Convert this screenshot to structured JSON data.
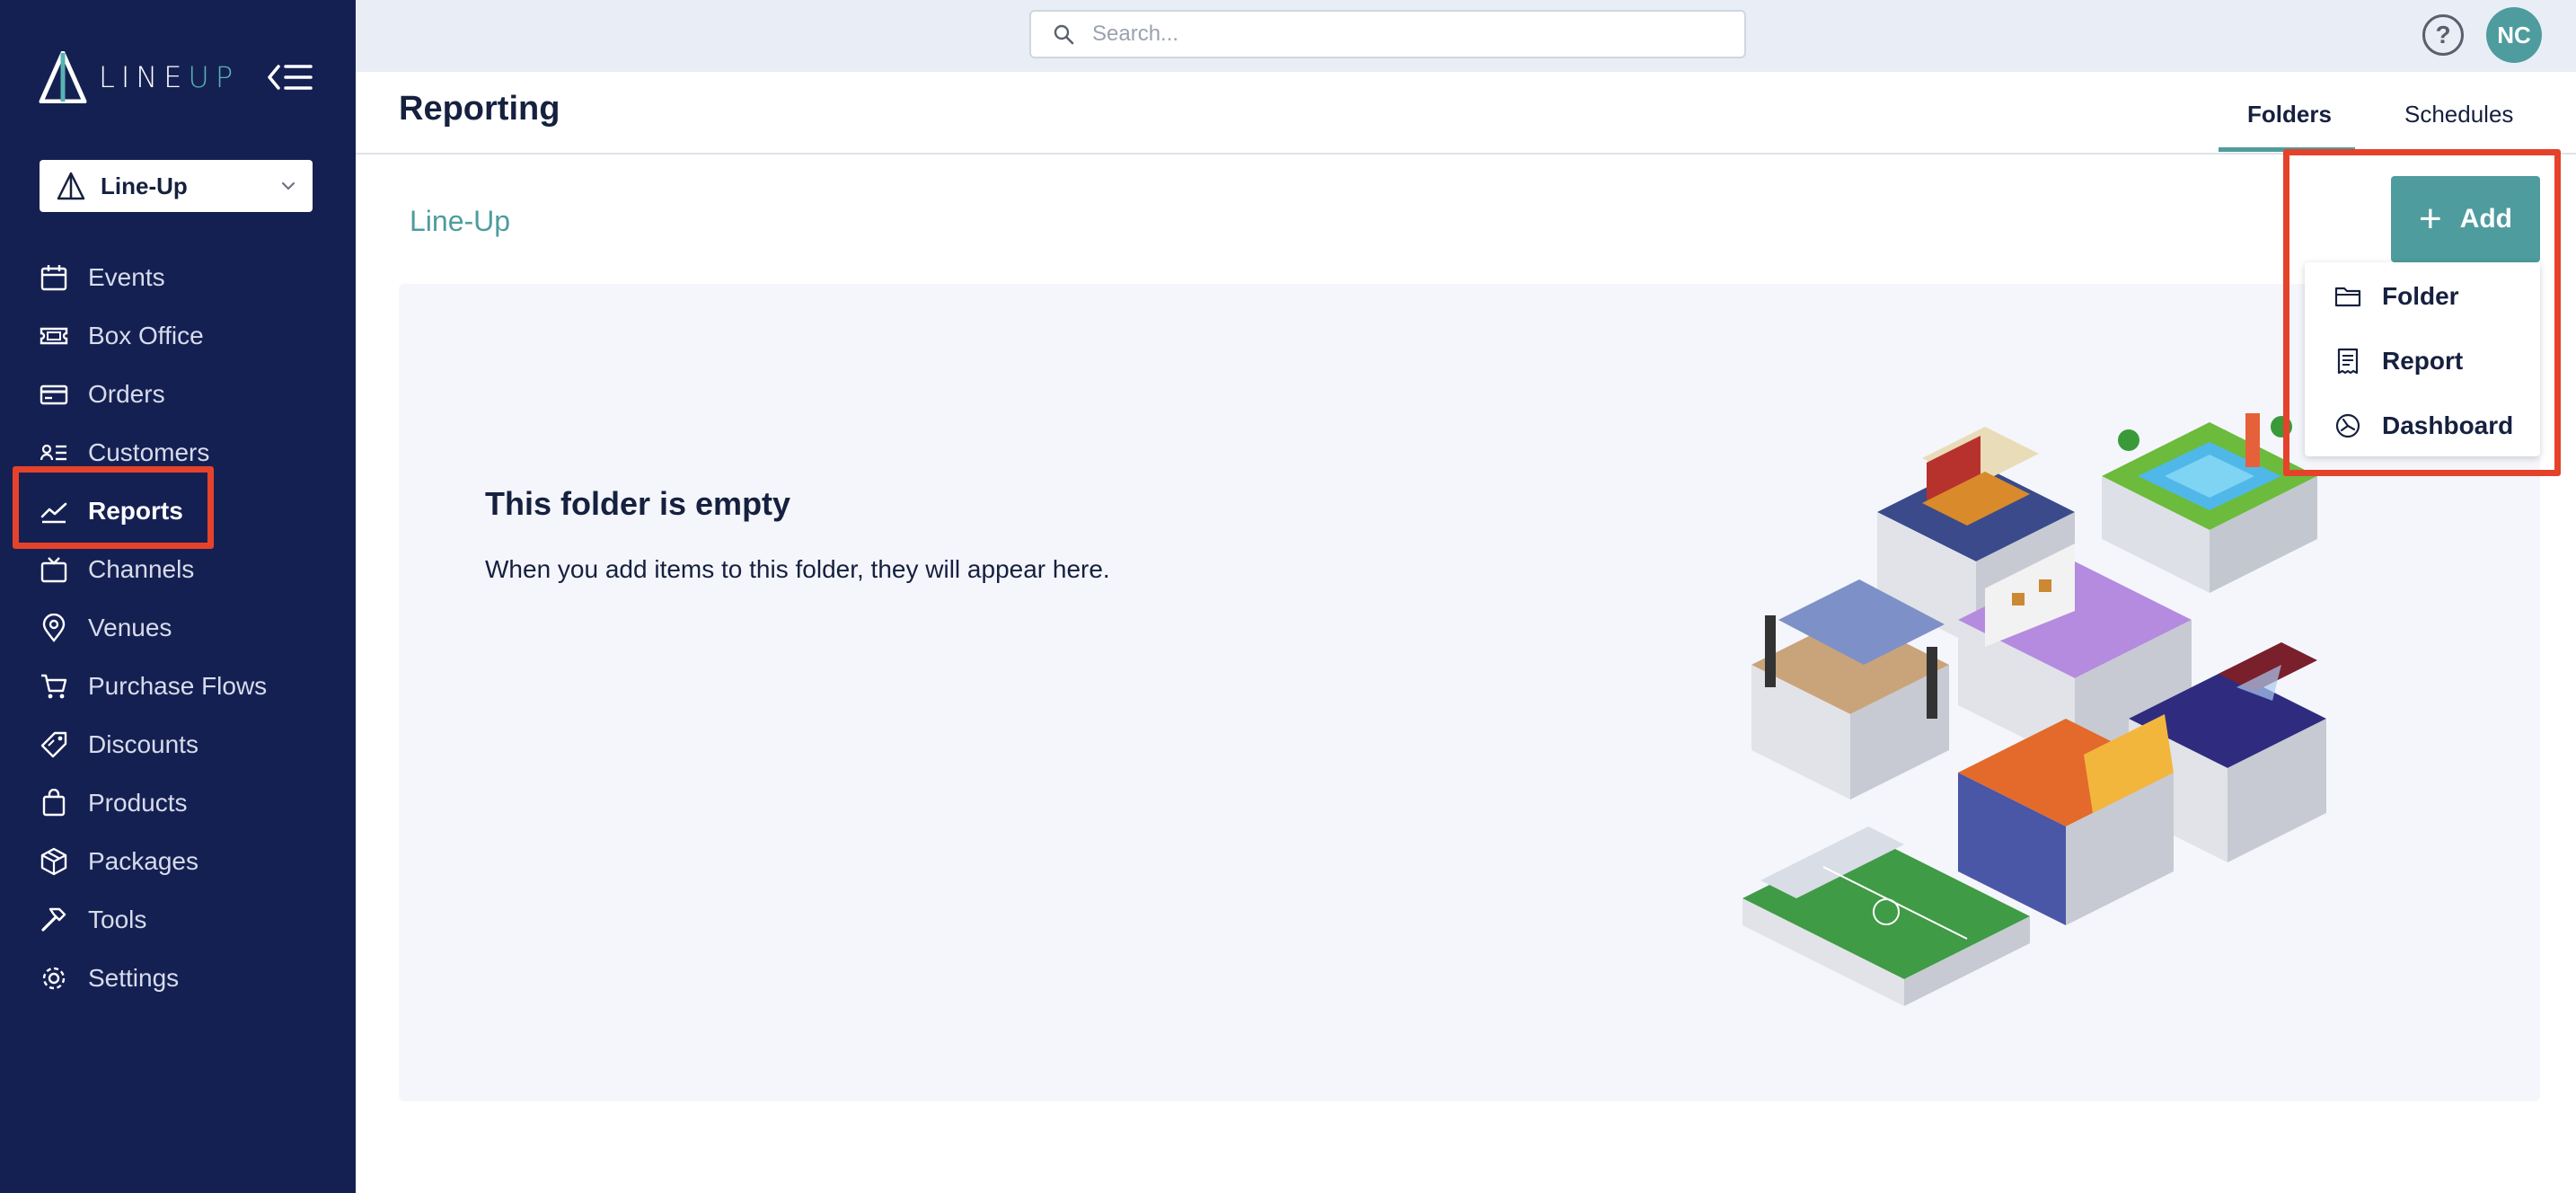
{
  "app": {
    "logo_text_a": "LINE",
    "logo_text_b": "UP"
  },
  "org_selector": {
    "label": "Line-Up"
  },
  "nav": {
    "items": [
      {
        "label": "Events",
        "icon": "calendar-icon"
      },
      {
        "label": "Box Office",
        "icon": "ticket-icon"
      },
      {
        "label": "Orders",
        "icon": "credit-card-icon"
      },
      {
        "label": "Customers",
        "icon": "contact-card-icon"
      },
      {
        "label": "Reports",
        "icon": "trend-chart-icon",
        "active": true
      },
      {
        "label": "Channels",
        "icon": "tv-icon"
      },
      {
        "label": "Venues",
        "icon": "map-pin-icon"
      },
      {
        "label": "Purchase Flows",
        "icon": "cart-icon"
      },
      {
        "label": "Discounts",
        "icon": "tag-icon"
      },
      {
        "label": "Products",
        "icon": "shopping-bag-icon"
      },
      {
        "label": "Packages",
        "icon": "package-icon"
      },
      {
        "label": "Tools",
        "icon": "hammer-icon"
      },
      {
        "label": "Settings",
        "icon": "gear-icon"
      }
    ]
  },
  "search": {
    "placeholder": "Search..."
  },
  "user": {
    "initials": "NC",
    "help": "?"
  },
  "header": {
    "title": "Reporting",
    "tabs": [
      {
        "label": "Folders",
        "active": true
      },
      {
        "label": "Schedules",
        "active": false
      }
    ]
  },
  "breadcrumb": "Line-Up",
  "add_button": {
    "label": "Add"
  },
  "add_menu": {
    "items": [
      {
        "label": "Folder",
        "icon": "folder-icon"
      },
      {
        "label": "Report",
        "icon": "report-document-icon"
      },
      {
        "label": "Dashboard",
        "icon": "dashboard-gauge-icon"
      }
    ]
  },
  "empty_state": {
    "title": "This folder is empty",
    "description": "When you add items to this folder, they will appear here."
  },
  "colors": {
    "sidebar_bg": "#152052",
    "accent": "#4e9c9e",
    "highlight": "#e5422b",
    "topbar_bg": "#e9eef6",
    "panel_bg": "#f4f6fb"
  }
}
